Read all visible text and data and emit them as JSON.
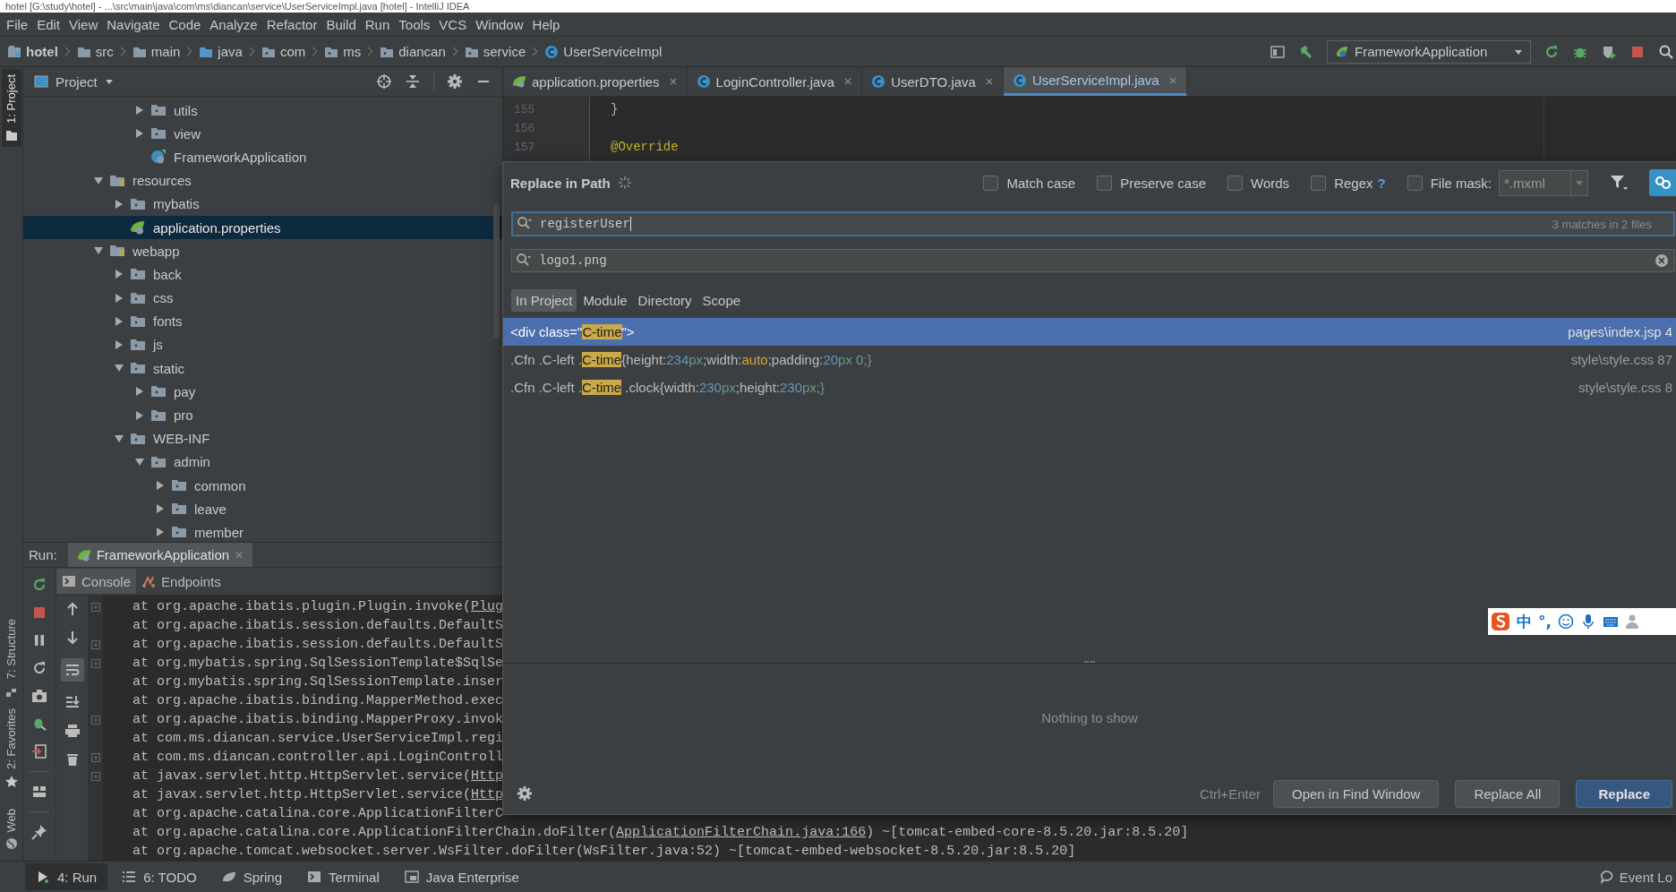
{
  "window": {
    "title": "hotel [G:\\study\\hotel] - ...\\src\\main\\java\\com\\ms\\diancan\\service\\UserServiceImpl.java [hotel] - IntelliJ IDEA"
  },
  "menu": [
    "File",
    "Edit",
    "View",
    "Navigate",
    "Code",
    "Analyze",
    "Refactor",
    "Build",
    "Run",
    "Tools",
    "VCS",
    "Window",
    "Help"
  ],
  "breadcrumbs": [
    {
      "label": "hotel",
      "kind": "module"
    },
    {
      "label": "src",
      "kind": "folder"
    },
    {
      "label": "main",
      "kind": "folder"
    },
    {
      "label": "java",
      "kind": "source-folder"
    },
    {
      "label": "com",
      "kind": "package"
    },
    {
      "label": "ms",
      "kind": "package"
    },
    {
      "label": "diancan",
      "kind": "package"
    },
    {
      "label": "service",
      "kind": "package"
    },
    {
      "label": "UserServiceImpl",
      "kind": "class"
    }
  ],
  "run_config": "FrameworkApplication",
  "side_tabs": [
    {
      "label": "1: Project",
      "kind": "project",
      "selected": true
    },
    {
      "label": "7: Structure",
      "kind": "structure",
      "selected": false
    },
    {
      "label": "2: Favorites",
      "kind": "favorites",
      "selected": false
    },
    {
      "label": "Web",
      "kind": "web",
      "selected": false
    }
  ],
  "project_panel": {
    "title": "Project",
    "tree": [
      {
        "children": [
          {
            "children": [
              {
                "label": "utils",
                "kind": "folder",
                "expanded": false,
                "selected": false
              },
              {
                "label": "view",
                "kind": "folder",
                "expanded": false,
                "selected": false
              },
              {
                "label": "FrameworkApplication",
                "kind": "spring-class",
                "selected": false
              }
            ]
          }
        ]
      },
      {
        "label": "resources",
        "kind": "resource-folder",
        "expanded": true,
        "selected": false,
        "children": [
          {
            "label": "mybatis",
            "kind": "folder",
            "expanded": false,
            "selected": false
          },
          {
            "label": "application.properties",
            "kind": "spring-config",
            "selected": true
          }
        ]
      },
      {
        "label": "webapp",
        "kind": "resource-folder",
        "expanded": true,
        "selected": false,
        "children": [
          {
            "label": "back",
            "kind": "folder",
            "expanded": false,
            "selected": false
          },
          {
            "label": "css",
            "kind": "folder",
            "expanded": false,
            "selected": false
          },
          {
            "label": "fonts",
            "kind": "folder",
            "expanded": false,
            "selected": false
          },
          {
            "label": "js",
            "kind": "folder",
            "expanded": false,
            "selected": false
          },
          {
            "label": "static",
            "kind": "folder",
            "expanded": true,
            "selected": false,
            "children": [
              {
                "label": "pay",
                "kind": "folder",
                "expanded": false,
                "selected": false
              },
              {
                "label": "pro",
                "kind": "folder",
                "expanded": false,
                "selected": false
              }
            ]
          },
          {
            "label": "WEB-INF",
            "kind": "folder",
            "expanded": true,
            "selected": false,
            "children": [
              {
                "label": "admin",
                "kind": "folder",
                "expanded": true,
                "selected": false,
                "children": [
                  {
                    "label": "common",
                    "kind": "folder",
                    "expanded": false,
                    "selected": false
                  },
                  {
                    "label": "leave",
                    "kind": "folder",
                    "expanded": false,
                    "selected": false
                  },
                  {
                    "label": "member",
                    "kind": "folder",
                    "expanded": false,
                    "selected": false
                  }
                ]
              }
            ]
          }
        ]
      }
    ]
  },
  "editor": {
    "tabs": [
      {
        "label": "application.properties",
        "kind": "properties",
        "selected": false
      },
      {
        "label": "LoginController.java",
        "kind": "class",
        "selected": false
      },
      {
        "label": "UserDTO.java",
        "kind": "class",
        "selected": false
      },
      {
        "label": "UserServiceImpl.java",
        "kind": "class",
        "selected": true
      }
    ],
    "lines": [
      {
        "number": "155",
        "code": "}",
        "kind": "plain"
      },
      {
        "number": "156"
      },
      {
        "number": "157",
        "code": "@Override",
        "kind": "annotation"
      }
    ]
  },
  "run_panel": {
    "label": "Run:",
    "tabs": [
      {
        "label": "FrameworkApplication",
        "selected": true
      }
    ],
    "console_tabs": [
      {
        "label": "Console",
        "kind": "console",
        "selected": true
      },
      {
        "label": "Endpoints",
        "kind": "endpoints",
        "selected": false
      }
    ],
    "lines": [
      {
        "text": "at org.apache.ibatis.plugin.Plugin.invoke(",
        "link": "Plug",
        "fold": true
      },
      {
        "text": "at org.apache.ibatis.session.defaults.DefaultS",
        "fold": false
      },
      {
        "text": "at org.apache.ibatis.session.defaults.DefaultS",
        "fold": true
      },
      {
        "text": "at org.mybatis.spring.SqlSessionTemplate$SqlSe",
        "fold": true
      },
      {
        "text": "at org.mybatis.spring.SqlSessionTemplate.inser",
        "fold": false
      },
      {
        "text": "at org.apache.ibatis.binding.MapperMethod.exec",
        "fold": false
      },
      {
        "text": "at org.apache.ibatis.binding.MapperProxy.invok",
        "fold": true
      },
      {
        "text": "at com.ms.diancan.service.UserServiceImpl.regi",
        "fold": false
      },
      {
        "text": "at com.ms.diancan.controller.api.LoginControll",
        "fold": true
      },
      {
        "text": "at javax.servlet.http.HttpServlet.service(",
        "link": "Http",
        "fold": true
      },
      {
        "text": "at javax.servlet.http.HttpServlet.service(",
        "link": "Http",
        "fold": false
      },
      {
        "text": "at org.apache.catalina.core.ApplicationFilterC",
        "fold": false
      },
      {
        "text": "at org.apache.catalina.core.ApplicationFilterChain.doFilter(",
        "link": "ApplicationFilterChain.java:166",
        "tail": ") ~[tomcat-embed-core-8.5.20.jar:8.5.20]",
        "fold": false
      },
      {
        "text": "at org.apache.tomcat.websocket.server.WsFilter.doFilter(WsFilter.java:52) ~[tomcat-embed-websocket-8.5.20.jar:8.5.20]",
        "fold": false
      }
    ]
  },
  "bottom_bar": {
    "items": [
      {
        "label": "4: Run",
        "kind": "run",
        "selected": true
      },
      {
        "label": "6: TODO",
        "kind": "todo",
        "selected": false
      },
      {
        "label": "Spring",
        "kind": "spring",
        "selected": false
      },
      {
        "label": "Terminal",
        "kind": "terminal",
        "selected": false
      },
      {
        "label": "Java Enterprise",
        "kind": "javaee",
        "selected": false
      }
    ],
    "event_log": "Event Lo"
  },
  "replace_dialog": {
    "title": "Replace in Path",
    "options": [
      {
        "label": "Match case",
        "checked": false
      },
      {
        "label": "Preserve case",
        "checked": false
      },
      {
        "label": "Words",
        "checked": false
      },
      {
        "label": "Regex",
        "checked": false,
        "help": "?"
      },
      {
        "label": "File mask:",
        "checked": false
      }
    ],
    "file_mask": "*.mxml",
    "search": {
      "value": "registerUser",
      "status": "3 matches in 2 files"
    },
    "replace": {
      "value": "logo1.png"
    },
    "scopes": [
      {
        "label": "In Project",
        "selected": true
      },
      {
        "label": "Module",
        "selected": false
      },
      {
        "label": "Directory",
        "selected": false
      },
      {
        "label": "Scope",
        "selected": false
      }
    ],
    "results": [
      {
        "selected": true,
        "location": "pages\\index.jsp 4",
        "parts": [
          {
            "kind": "plain",
            "text": "<div class=\""
          },
          {
            "kind": "match",
            "text": "C-time"
          },
          {
            "kind": "plain",
            "text": "\">"
          }
        ]
      },
      {
        "selected": false,
        "location": "style\\style.css 87",
        "parts": [
          {
            "kind": "plain",
            "text": ".Cfn .C-left ."
          },
          {
            "kind": "match",
            "text": "C-time"
          },
          {
            "kind": "plain",
            "text": "{height:"
          },
          {
            "kind": "number",
            "text": "234"
          },
          {
            "kind": "unit",
            "text": "px"
          },
          {
            "kind": "plain",
            "text": ";width:"
          },
          {
            "kind": "value",
            "text": "auto"
          },
          {
            "kind": "plain",
            "text": ";padding:"
          },
          {
            "kind": "number",
            "text": "20"
          },
          {
            "kind": "unit",
            "text": "px 0;}"
          }
        ]
      },
      {
        "selected": false,
        "location": "style\\style.css 8",
        "parts": [
          {
            "kind": "plain",
            "text": ".Cfn .C-left ."
          },
          {
            "kind": "match",
            "text": "C-time"
          },
          {
            "kind": "plain",
            "text": " .clock{width:"
          },
          {
            "kind": "number",
            "text": "230"
          },
          {
            "kind": "unit",
            "text": "px"
          },
          {
            "kind": "plain",
            "text": ";height:"
          },
          {
            "kind": "number",
            "text": "230"
          },
          {
            "kind": "unit",
            "text": "px;}"
          }
        ]
      }
    ],
    "preview": "Nothing to show",
    "shortcut": "Ctrl+Enter",
    "buttons": [
      {
        "label": "Open in Find Window",
        "kind": "normal"
      },
      {
        "label": "Replace All",
        "kind": "normal"
      },
      {
        "label": "Replace",
        "kind": "default"
      }
    ]
  },
  "ime_toolbar": {
    "mode": "中",
    "punctuation": "°,"
  }
}
